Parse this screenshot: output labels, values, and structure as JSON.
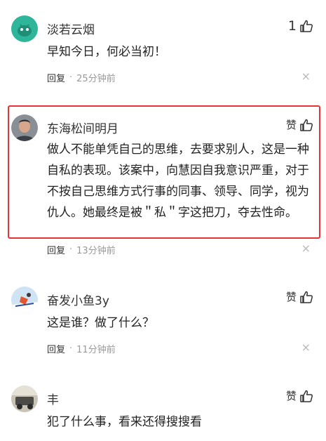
{
  "comments": [
    {
      "username": "淡若云烟",
      "like_label": "1",
      "text": "早知今日，何必当初！",
      "reply_label": "回复",
      "separator": "·",
      "time": "25分钟前",
      "close": "×",
      "avatar_color": "#2fb59a"
    },
    {
      "username": "东海松间明月",
      "like_label": "赞",
      "text": "做人不能单凭自己的思维，去要求别人，这是一种自私的表现。该案中，向慧因自我意识严重，对于不按自己思维方式行事的同事、领导、同学，视为仇人。她最终是被＂私＂字这把刀，夺去性命。",
      "reply_label": "回复",
      "separator": "·",
      "time": "13分钟前",
      "close": "×",
      "highlight_color": "#e8323a"
    },
    {
      "username": "奋发小鱼3y",
      "like_label": "赞",
      "text": "这是谁？做了什么？",
      "reply_label": "回复",
      "separator": "·",
      "time": "11分钟前",
      "close": "×"
    },
    {
      "username": "丰",
      "like_label": "赞",
      "text": "犯了什么事，看来还得搜搜看"
    }
  ]
}
